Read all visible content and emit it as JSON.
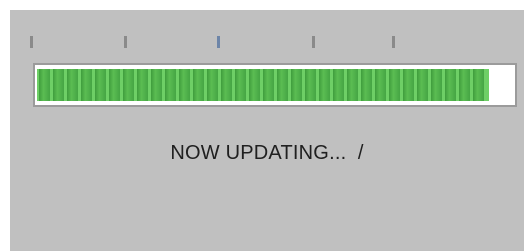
{
  "colors": {
    "panel": "#c0c0c0",
    "progress_fill": "#5bbd52",
    "progress_segment": "#3f9d3d",
    "track": "#ffffff"
  },
  "progress": {
    "value_fraction": 0.95,
    "scale_tick_count": 5
  },
  "status": {
    "text": "NOW UPDATING...  /"
  }
}
